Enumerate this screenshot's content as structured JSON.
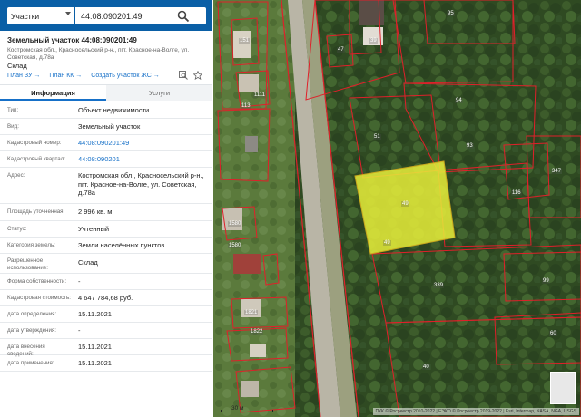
{
  "search": {
    "type_label": "Участки",
    "query": "44:08:090201:49"
  },
  "header": {
    "title": "Земельный участок 44:08:090201:49",
    "address": "Костромская обл., Красносельский р-н., пгт. Красное-на-Волге, ул. Советская, д.78а",
    "category": "Склад"
  },
  "links": {
    "plan_zu": "План ЗУ →",
    "plan_kk": "План КК →",
    "create_zs": "Создать участок ЖС →"
  },
  "tabs": {
    "info": "Информация",
    "services": "Услуги"
  },
  "info": [
    {
      "label": "Тип:",
      "value": "Объект недвижимости"
    },
    {
      "label": "Вид:",
      "value": "Земельный участок"
    },
    {
      "label": "Кадастровый номер:",
      "value": "44:08:090201:49"
    },
    {
      "label": "Кадастровый квартал:",
      "value": "44:08:090201"
    },
    {
      "label": "Адрес:",
      "value": "Костромская обл., Красносельский р-н., пгт. Красное-на-Волге, ул. Советская, д.78а"
    },
    {
      "label": "Площадь уточненная:",
      "value": "2 996 кв. м"
    },
    {
      "label": "Статус:",
      "value": "Учтенный"
    },
    {
      "label": "Категория земель:",
      "value": "Земли населённых пунктов"
    },
    {
      "label": "Разрешенное использование:",
      "value": "Склад"
    },
    {
      "label": "Форма собственности:",
      "value": "-"
    },
    {
      "label": "Кадастровая стоимость:",
      "value": "4 647 784,68 руб."
    },
    {
      "label": "дата определения:",
      "value": "15.11.2021"
    },
    {
      "label": "дата утверждения:",
      "value": "-"
    },
    {
      "label": "дата внесения сведений:",
      "value": "15.11.2021"
    },
    {
      "label": "дата применения:",
      "value": "15.11.2021"
    }
  ],
  "map": {
    "scale_label": "30 м",
    "attribution": "ПКК © Росреестр 2010-2022 | ЕЭКО © Росреестр 2019-2022 | Esri, Intermap, NASA, NGA, USGS",
    "plot_labels": [
      "151",
      "39",
      "47",
      "95",
      "1111",
      "113",
      "94",
      "51",
      "93",
      "49",
      "347",
      "116",
      "1580",
      "1580",
      "49",
      "339",
      "1821",
      "1822",
      "99",
      "60",
      "40"
    ],
    "highlight_color": "#e8ef3a",
    "boundary_color": "#e0202a"
  }
}
